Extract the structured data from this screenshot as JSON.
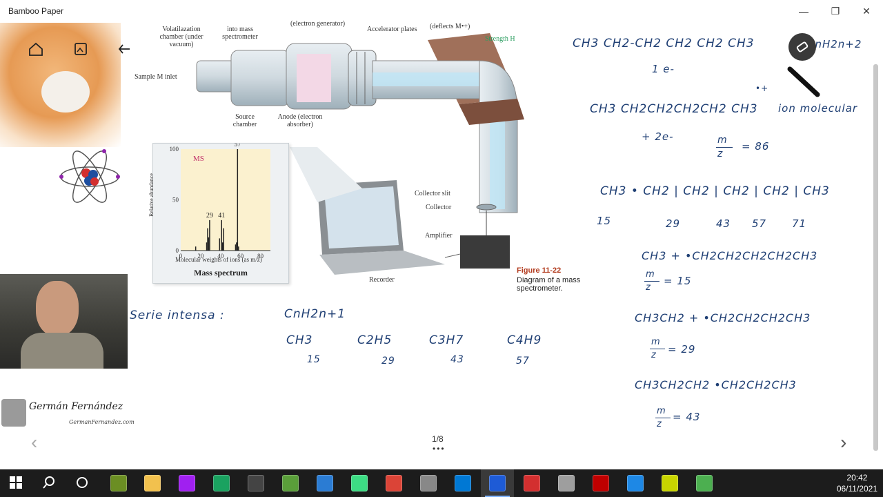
{
  "app": {
    "title": "Bamboo Paper"
  },
  "window_controls": {
    "minimize": "—",
    "maximize": "❐",
    "close": "✕"
  },
  "left_toolbar": {
    "home_icon": "home-icon",
    "gallery_icon": "gallery-icon",
    "back_icon": "undo-arrow-icon"
  },
  "pen_tools": {
    "pen_icon": "pen-icon",
    "eraser_icon": "eraser-icon"
  },
  "branding": {
    "name": "Germán Fernández",
    "url": "GermanFernandez.com"
  },
  "figure": {
    "labels": {
      "volatilization": "Volatilazation chamber (under vacuum)",
      "into_ms": "into mass spectrometer",
      "electron_gen": "(electron generator)",
      "accelerator": "Accelerator plates",
      "deflects": "(deflects M•+)",
      "strength": "Strength H",
      "sample_inlet": "Sample M inlet",
      "source_chamber": "Source chamber",
      "anode": "Anode (electron absorber)",
      "collector_slit": "Collector slit",
      "collector": "Collector",
      "amplifier": "Amplifier",
      "recorder": "Recorder",
      "caption_bold": "Figure 11-22",
      "caption_text": "Diagram of a mass spectrometer."
    },
    "ion_label": "M•+",
    "molecule_label": "M"
  },
  "mass_spectrum": {
    "panel_label": "MS",
    "ylabel": "Relative abundance",
    "xlabel": "Molecular weights of ions (as m/z)",
    "title": "Mass spectrum",
    "peak_labels": [
      "29",
      "41",
      "57"
    ]
  },
  "chart_data": {
    "type": "bar",
    "title": "Mass spectrum",
    "xlabel": "Molecular weights of ions (as m/z)",
    "ylabel": "Relative abundance",
    "xlim": [
      0,
      90
    ],
    "ylim": [
      0,
      100
    ],
    "xticks": [
      0,
      20,
      40,
      60,
      80
    ],
    "yticks": [
      0,
      50,
      100
    ],
    "series": [
      {
        "x": [
          15,
          26,
          27,
          28,
          29,
          39,
          41,
          42,
          43,
          55,
          56,
          57,
          58
        ],
        "values": [
          4,
          8,
          22,
          13,
          30,
          12,
          30,
          8,
          22,
          6,
          8,
          100,
          4
        ]
      }
    ]
  },
  "notes": {
    "line1": "CH3 CH2-CH2 CH2 CH2 CH3",
    "line1_tail": "CnH2n+2",
    "line2": "1 e-",
    "line3": "CH3 CH2CH2CH2CH2 CH3",
    "line3_sup": "•+",
    "line3_tail": "ion molecular",
    "line4": "+ 2e-",
    "mz1_num": "m",
    "mz1_den": "z",
    "mz1_val": "= 86",
    "chain": "CH3 • CH2 | CH2 | CH2 | CH2 | CH3",
    "frag_nums": [
      "15",
      "29",
      "43",
      "57",
      "71"
    ],
    "line6": "CH3 + •CH2CH2CH2CH2CH3",
    "line6_mz": "= 15",
    "line7": "CH3CH2 + •CH2CH2CH2CH3",
    "line7_mz": "= 29",
    "line8": "CH3CH2CH2    •CH2CH2CH3",
    "line8_mz": "= 43",
    "serie_label": "Serie intensa :",
    "serie_formula": "CnH2n+1",
    "serie_items": [
      "CH3",
      "C2H5",
      "C3H7",
      "C4H9"
    ],
    "serie_nums": [
      "15",
      "29",
      "43",
      "57"
    ]
  },
  "pagination": {
    "page": "1/8",
    "dots": "•••",
    "prev": "‹",
    "next": "›"
  },
  "taskbar": {
    "time": "20:42",
    "date": "06/11/2021",
    "apps": [
      {
        "name": "start-icon",
        "color": "#ffffff"
      },
      {
        "name": "search-icon",
        "color": "#ffffff"
      },
      {
        "name": "cortana-icon",
        "color": "#ffffff"
      },
      {
        "name": "app-icon-1",
        "color": "#6b8e23"
      },
      {
        "name": "explorer-icon",
        "color": "#f2c14e"
      },
      {
        "name": "app-icon-purple",
        "color": "#a020f0"
      },
      {
        "name": "app-icon-green",
        "color": "#1aa260"
      },
      {
        "name": "app-icon-dark",
        "color": "#444444"
      },
      {
        "name": "app-icon-photo",
        "color": "#5a9e3a"
      },
      {
        "name": "app-icon-blue",
        "color": "#2b7cd3"
      },
      {
        "name": "android-icon",
        "color": "#3ddc84"
      },
      {
        "name": "chrome-icon",
        "color": "#db4437"
      },
      {
        "name": "app-icon-bw",
        "color": "#888888"
      },
      {
        "name": "mail-icon",
        "color": "#0078d4"
      },
      {
        "name": "bamboo-paper-icon",
        "color": "#1e5bd6"
      },
      {
        "name": "pdf-icon",
        "color": "#d32f2f"
      },
      {
        "name": "media-icon",
        "color": "#9e9e9e"
      },
      {
        "name": "filezilla-icon",
        "color": "#bf0000"
      },
      {
        "name": "app-icon-globe",
        "color": "#1e88e5"
      },
      {
        "name": "app-icon-yellow",
        "color": "#c8d400"
      },
      {
        "name": "app-icon-green2",
        "color": "#4caf50"
      }
    ]
  }
}
